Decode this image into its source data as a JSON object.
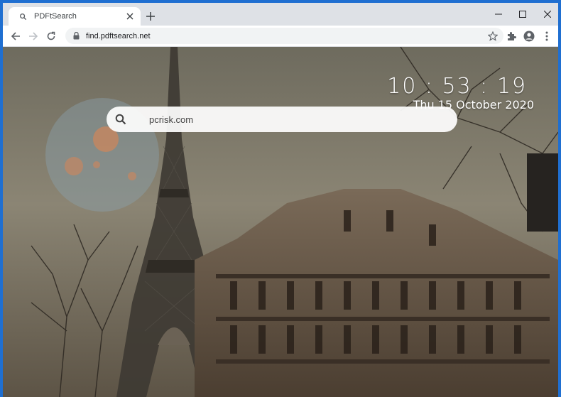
{
  "tab": {
    "title": "PDFtSearch"
  },
  "address_bar": {
    "url": "find.pdftsearch.net"
  },
  "page": {
    "clock": "10 : 53 : 19",
    "date": "Thu 15 October 2020",
    "search": {
      "value": "pcrisk.com"
    }
  },
  "colors": {
    "window_frame": "#1f6fd1",
    "tabstrip": "#dee1e6",
    "omnibox": "#f1f3f4"
  },
  "icons": [
    "search-icon",
    "close-icon",
    "plus-icon",
    "minimize-icon",
    "maximize-icon",
    "window-close-icon",
    "back-icon",
    "forward-icon",
    "reload-icon",
    "lock-icon",
    "star-icon",
    "puzzle-icon",
    "account-icon",
    "menu-icon"
  ]
}
